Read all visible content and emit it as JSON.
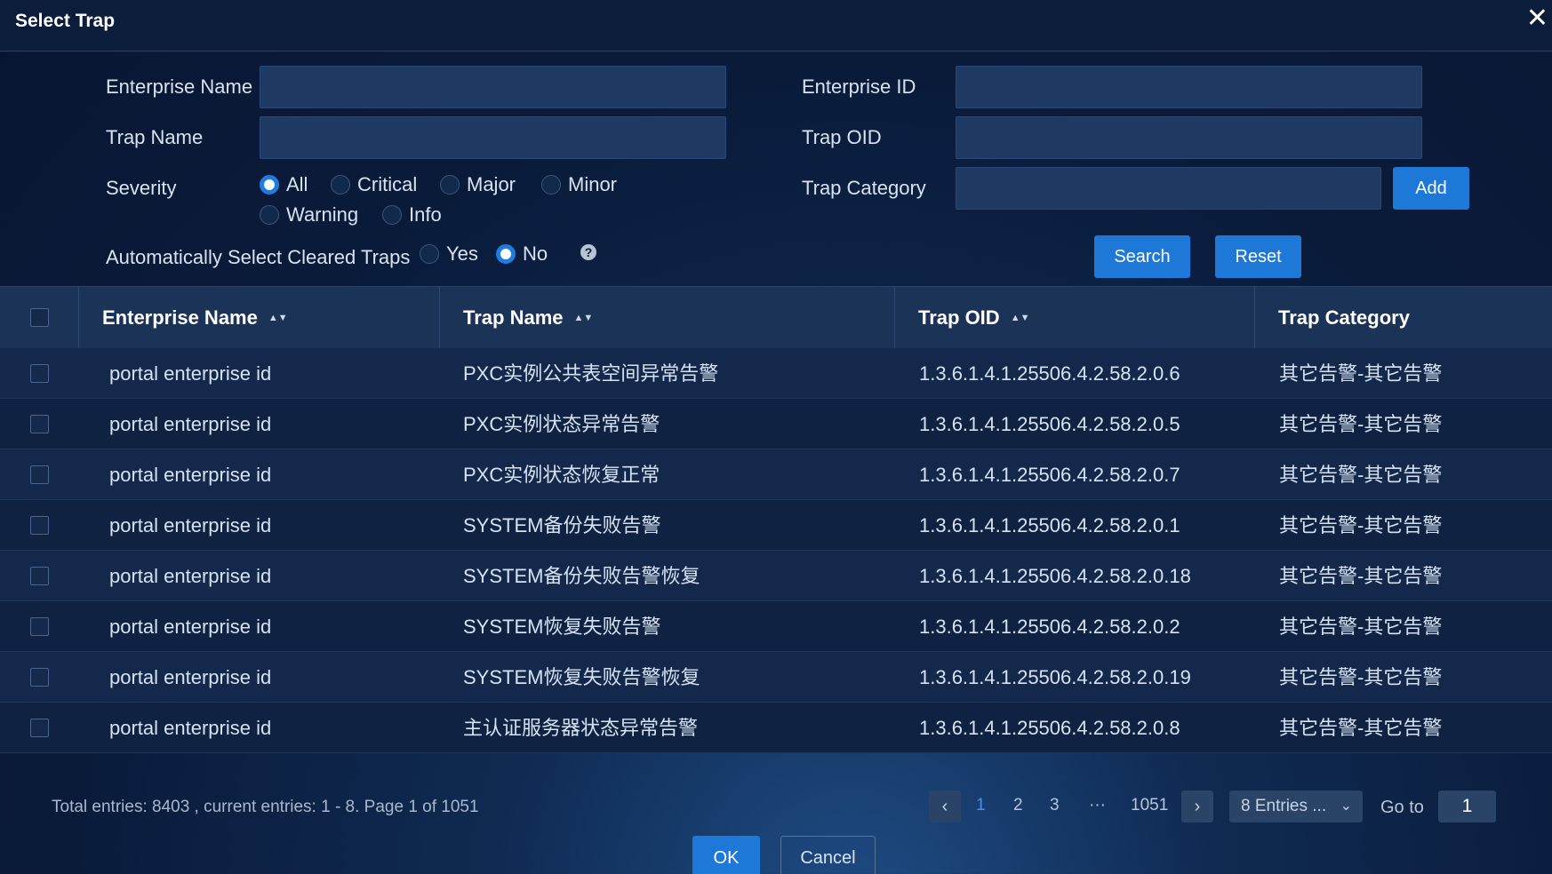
{
  "dialog": {
    "title": "Select Trap",
    "close_icon": "close-icon"
  },
  "filters": {
    "enterprise_name_label": "Enterprise Name",
    "enterprise_name_value": "",
    "enterprise_id_label": "Enterprise ID",
    "enterprise_id_value": "",
    "trap_name_label": "Trap Name",
    "trap_name_value": "",
    "trap_oid_label": "Trap OID",
    "trap_oid_value": "",
    "severity_label": "Severity",
    "severity_options": [
      "All",
      "Critical",
      "Major",
      "Minor",
      "Warning",
      "Info"
    ],
    "severity_selected": "All",
    "trap_category_label": "Trap Category",
    "trap_category_value": "",
    "add_label": "Add",
    "auto_select_label": "Automatically Select Cleared Traps",
    "auto_select_options": [
      "Yes",
      "No"
    ],
    "auto_select_selected": "No",
    "help_glyph": "?",
    "search_label": "Search",
    "reset_label": "Reset"
  },
  "table": {
    "columns": [
      "Enterprise Name",
      "Trap Name",
      "Trap OID",
      "Trap Category"
    ],
    "sort_glyph": "▲▼",
    "rows": [
      [
        "portal enterprise id",
        "PXC实例公共表空间异常告警",
        "1.3.6.1.4.1.25506.4.2.58.2.0.6",
        "其它告警-其它告警"
      ],
      [
        "portal enterprise id",
        "PXC实例状态异常告警",
        "1.3.6.1.4.1.25506.4.2.58.2.0.5",
        "其它告警-其它告警"
      ],
      [
        "portal enterprise id",
        "PXC实例状态恢复正常",
        "1.3.6.1.4.1.25506.4.2.58.2.0.7",
        "其它告警-其它告警"
      ],
      [
        "portal enterprise id",
        "SYSTEM备份失败告警",
        "1.3.6.1.4.1.25506.4.2.58.2.0.1",
        "其它告警-其它告警"
      ],
      [
        "portal enterprise id",
        "SYSTEM备份失败告警恢复",
        "1.3.6.1.4.1.25506.4.2.58.2.0.18",
        "其它告警-其它告警"
      ],
      [
        "portal enterprise id",
        "SYSTEM恢复失败告警",
        "1.3.6.1.4.1.25506.4.2.58.2.0.2",
        "其它告警-其它告警"
      ],
      [
        "portal enterprise id",
        "SYSTEM恢复失败告警恢复",
        "1.3.6.1.4.1.25506.4.2.58.2.0.19",
        "其它告警-其它告警"
      ],
      [
        "portal enterprise id",
        "主认证服务器状态异常告警",
        "1.3.6.1.4.1.25506.4.2.58.2.0.8",
        "其它告警-其它告警"
      ]
    ]
  },
  "pagination": {
    "summary": "Total entries: 8403 , current entries: 1 - 8. Page 1 of 1051",
    "prev_glyph": "‹",
    "next_glyph": "›",
    "pages": [
      "1",
      "2",
      "3",
      "···",
      "1051"
    ],
    "active_page": "1",
    "page_size_label": "8 Entries ...",
    "chevron_glyph": "⌄",
    "goto_label": "Go to",
    "goto_value": "1"
  },
  "actions": {
    "ok_label": "OK",
    "cancel_label": "Cancel"
  },
  "colors": {
    "accent": "#1d78d8",
    "background": "#0a1b3a",
    "active_page": "#3d92ff"
  }
}
